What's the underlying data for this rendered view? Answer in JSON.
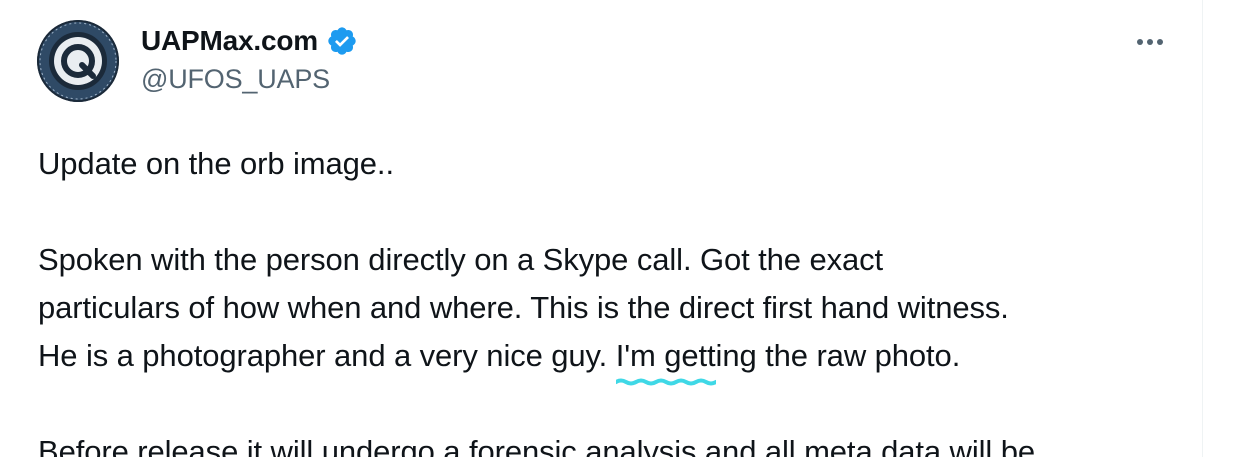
{
  "author": {
    "display_name": "UAPMax.com",
    "handle": "@UFOS_UAPS",
    "avatar_icon": "uapmax-logo-icon",
    "verified_icon": "verified-badge-icon"
  },
  "more_icon": "more-options-icon",
  "tweet": {
    "line1": "Update on the orb image..",
    "line2": "Spoken with the person directly on a Skype call. Got the exact",
    "line3": "particulars of how when and where. This is the direct first hand witness.",
    "line4_prefix": "He is a photographer and a very nice guy. ",
    "line4_highlight": "I'm getting the raw photo.",
    "line5": "Before release it will undergo a forensic analysis and all meta data will be"
  },
  "colors": {
    "text_primary": "#0f1419",
    "text_secondary": "#536471",
    "verified_blue": "#1d9bf0",
    "highlight_cyan": "#3fd8e6"
  }
}
